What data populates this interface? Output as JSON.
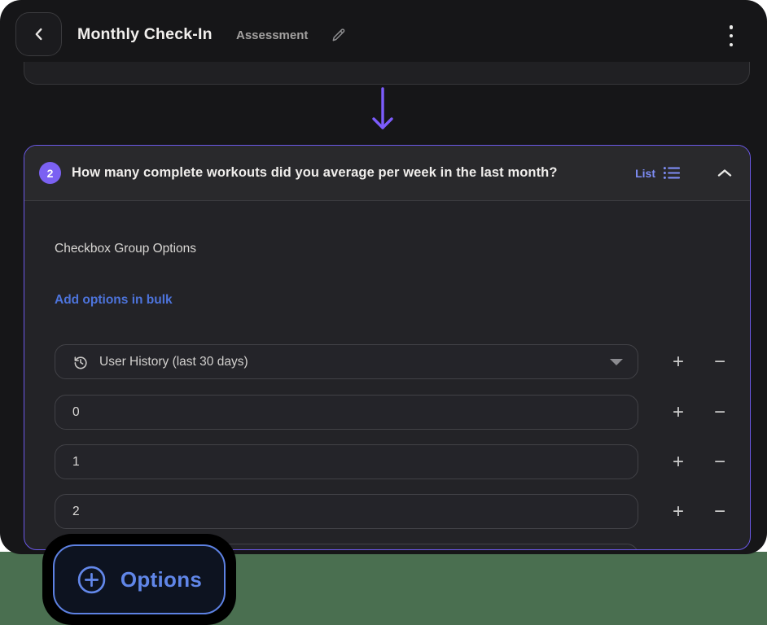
{
  "header": {
    "title": "Monthly Check-In",
    "subtitle": "Assessment"
  },
  "question_card": {
    "number": "2",
    "question": "How many complete workouts did you average per week in the last month?",
    "type_label": "List",
    "section_label": "Checkbox Group Options",
    "bulk_link_label": "Add options in bulk",
    "rows": [
      {
        "value": "User History (last 30 days)"
      },
      {
        "value": "0"
      },
      {
        "value": "1"
      },
      {
        "value": "2"
      }
    ],
    "plus_label": "+",
    "minus_label": "−"
  },
  "options_button": {
    "label": "Options"
  },
  "colors": {
    "accent_purple": "#7b61f2",
    "card_border_purple": "#6b59e8",
    "list_blue": "#7e8df6",
    "link_blue": "#4d74dc",
    "button_blue": "#5d81e2",
    "green_background": "#4a6f50",
    "app_background": "#161618"
  }
}
